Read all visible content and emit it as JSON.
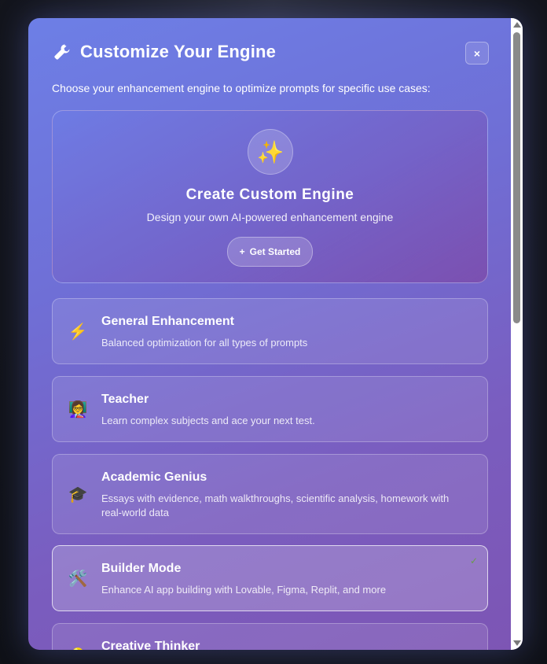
{
  "modal": {
    "title": "Customize Your Engine",
    "title_icon": "wrench-icon",
    "close_label": "×",
    "subtitle": "Choose your enhancement engine to optimize prompts for specific use cases:"
  },
  "custom_engine": {
    "icon": "✨",
    "title": "Create Custom Engine",
    "subtitle": "Design your own AI-powered enhancement engine",
    "button_icon": "+",
    "button_label": "Get Started"
  },
  "engines": [
    {
      "icon": "⚡",
      "icon_name": "lightning-icon",
      "name": "General Enhancement",
      "description": "Balanced optimization for all types of prompts",
      "selected": false
    },
    {
      "icon": "👩‍🏫",
      "icon_name": "teacher-icon",
      "name": "Teacher",
      "description": "Learn complex subjects and ace your next test.",
      "selected": false
    },
    {
      "icon": "🎓",
      "icon_name": "graduation-cap-icon",
      "name": "Academic Genius",
      "description": "Essays with evidence, math walkthroughs, scientific analysis, homework with real-world data",
      "selected": false
    },
    {
      "icon": "🛠️",
      "icon_name": "tools-icon",
      "name": "Builder Mode",
      "description": "Enhance AI app building with Lovable, Figma, Replit, and more",
      "selected": true,
      "check": "✓"
    },
    {
      "icon": "💡",
      "icon_name": "lightbulb-icon",
      "name": "Creative Thinker",
      "description": "",
      "selected": false
    }
  ],
  "colors": {
    "gradient_start": "#6d7fe6",
    "gradient_end": "#7d55b4",
    "check": "#6b9b4c"
  }
}
